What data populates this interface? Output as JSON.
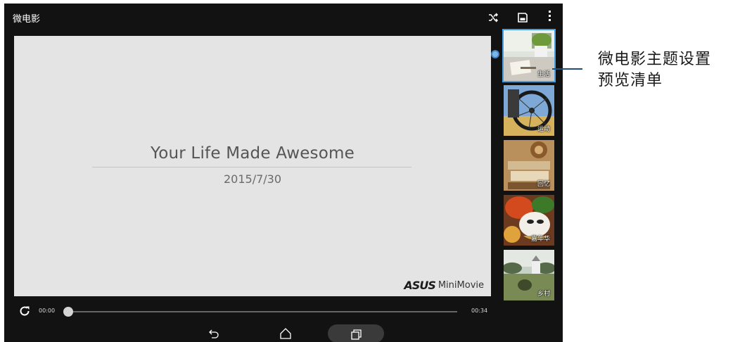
{
  "app": {
    "title": "微电影"
  },
  "toolbar": {
    "shuffle_icon": "shuffle-icon",
    "save_icon": "save-icon",
    "more_icon": "more-vert-icon"
  },
  "preview": {
    "title": "Your Life Made Awesome",
    "date": "2015/7/30",
    "brand_logo": "ASUS",
    "brand_name": "MiniMovie",
    "background": "#e4e4e4"
  },
  "player": {
    "time_current": "00:00",
    "time_total": "00:34",
    "progress": 0
  },
  "themes": [
    {
      "label": "生活",
      "selected": true
    },
    {
      "label": "运动",
      "selected": false
    },
    {
      "label": "回忆",
      "selected": false
    },
    {
      "label": "嘉年华",
      "selected": false
    },
    {
      "label": "乡村",
      "selected": false
    }
  ],
  "nav": {
    "back_icon": "back-icon",
    "home_icon": "home-icon",
    "recent_icon": "recent-apps-icon"
  },
  "callout": {
    "line1": "微电影主题设置",
    "line2": "预览清单",
    "color": "#1f4e79"
  },
  "colors": {
    "accent": "#4a9ee0",
    "device_bg": "#121212"
  }
}
